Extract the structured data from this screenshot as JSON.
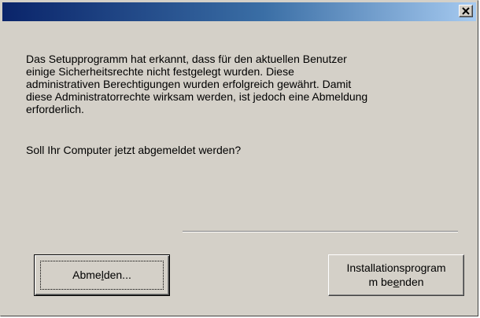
{
  "window": {
    "title": "",
    "close_icon": "close-icon"
  },
  "message": {
    "paragraph_1": "Das Setupprogramm hat erkannt, dass für den aktuellen Benutzer\neinige Sicherheitsrechte nicht festgelegt wurden. Diese\nadministrativen Berechtigungen wurden erfolgreich gewährt. Damit\ndiese Administratorrechte wirksam werden, ist jedoch eine Abmeldung\nerforderlich.",
    "question": "Soll Ihr Computer jetzt abgemeldet werden?"
  },
  "buttons": {
    "logout": {
      "before_mnemonic": "Abme",
      "mnemonic": "l",
      "after_mnemonic": "den..."
    },
    "exit": {
      "line_1": "Installationsprogram",
      "line_2_before": "m be",
      "line_2_mnemonic": "e",
      "line_2_after": "nden"
    }
  },
  "colors": {
    "dialog_face": "#d4d0c8",
    "titlebar_start": "#0a246a",
    "titlebar_end": "#a6caf0"
  }
}
